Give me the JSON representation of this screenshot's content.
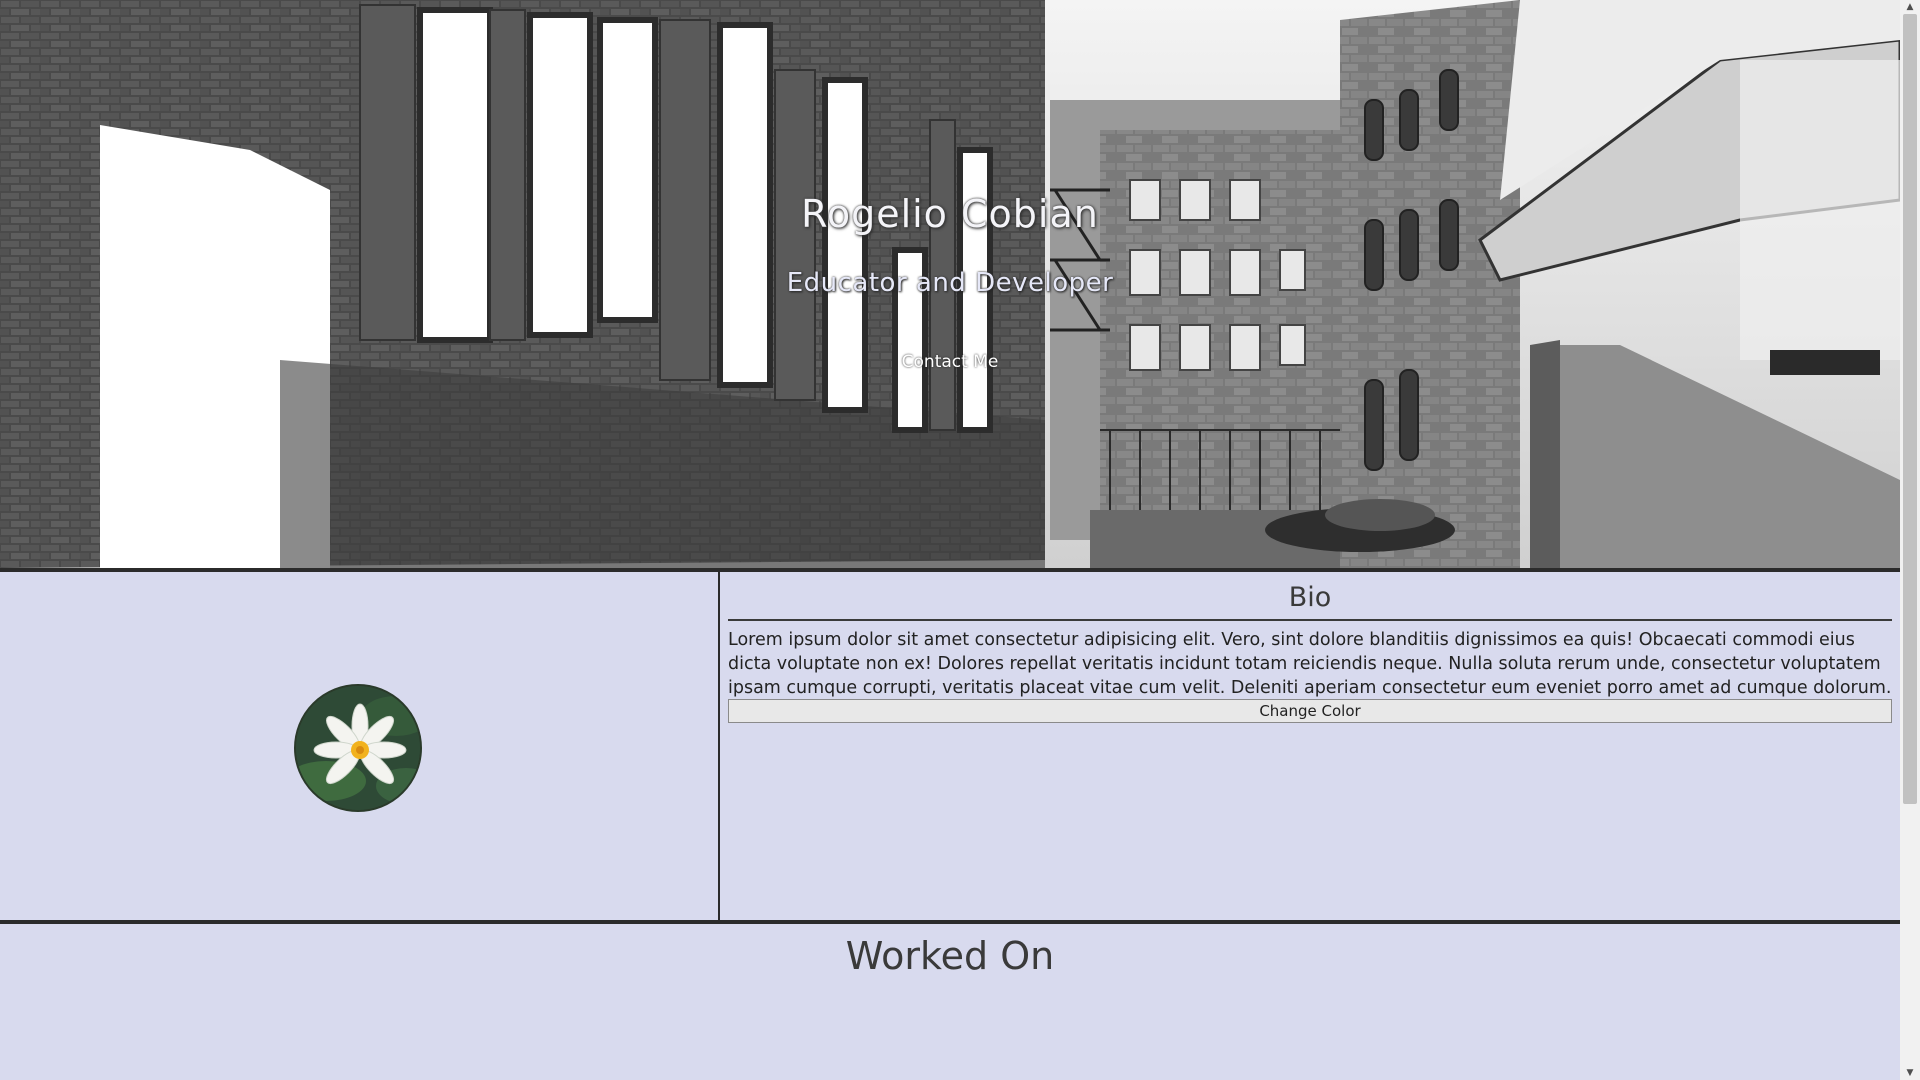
{
  "hero": {
    "title": "Rogelio Cobian",
    "subtitle": "Educator and Developer",
    "contact_label": "Contact Me"
  },
  "bio": {
    "heading": "Bio",
    "text": "Lorem ipsum dolor sit amet consectetur adipisicing elit. Vero, sint dolore blanditiis dignissimos ea quis! Obcaecati commodi eius dicta voluptate non ex! Dolores repellat veritatis incidunt totam reiciendis neque. Nulla soluta rerum unde, consectetur voluptatem ipsam cumque corrupti, veritatis placeat vitae cum velit. Deleniti aperiam consectetur eum eveniet porro amet ad cumque dolorum.",
    "button_label": "Change Color"
  },
  "worked_on": {
    "heading": "Worked On"
  },
  "colors": {
    "background": "#d8daee",
    "divider": "#2b2b2b",
    "heading_text": "#3a3a3a"
  }
}
